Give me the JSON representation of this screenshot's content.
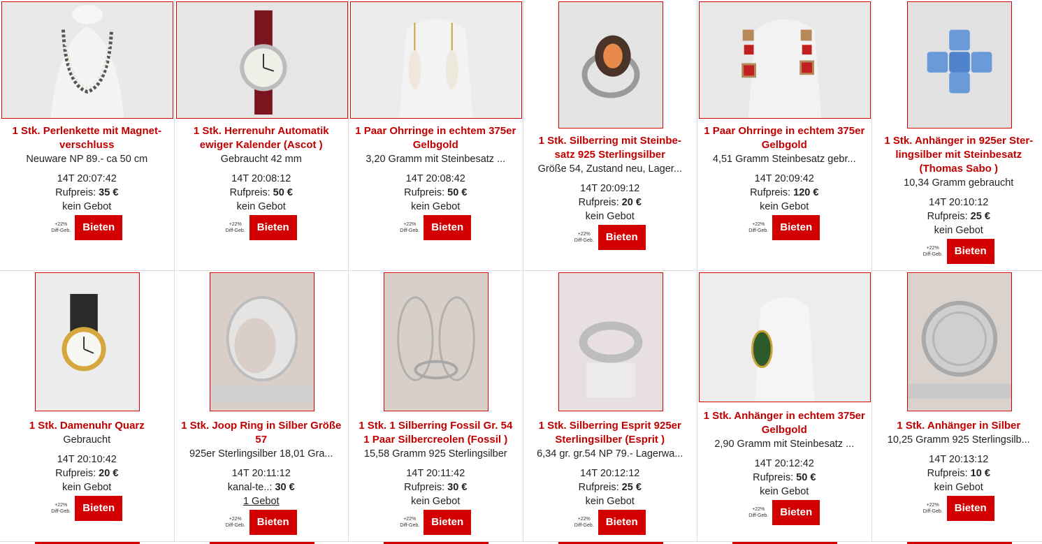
{
  "bid_button_label": "Bieten",
  "fee_note": [
    "+22%",
    "Diff-Geb."
  ],
  "price_label": "Rufpreis:",
  "colors": {
    "accent": "#d20000",
    "title": "#c00000"
  },
  "items": [
    {
      "title": "1 Stk. Perlenkette mit Magnet-verschluss",
      "desc": "Neuware NP 89.- ca 50 cm",
      "time": "14T 20:07:42",
      "price_label": "Rufpreis:",
      "price": "35 €",
      "bids": "kein Gebot",
      "image_icon": "necklace-icon"
    },
    {
      "title": "1 Stk. Herrenuhr Automatik ewiger Kalender (Ascot )",
      "desc": "Gebraucht 42 mm",
      "time": "14T 20:08:12",
      "price_label": "Rufpreis:",
      "price": "50 €",
      "bids": "kein Gebot",
      "image_icon": "watch-icon"
    },
    {
      "title": "1 Paar Ohrringe in echtem 375er Gelbgold",
      "desc": "3,20 Gramm mit Steinbesatz ...",
      "time": "14T 20:08:42",
      "price_label": "Rufpreis:",
      "price": "50 €",
      "bids": "kein Gebot",
      "image_icon": "earrings-icon"
    },
    {
      "title": "1 Stk. Silberring mit Steinbe-satz 925 Sterlingsilber",
      "desc": "Größe 54, Zustand neu, Lager...",
      "time": "14T 20:09:12",
      "price_label": "Rufpreis:",
      "price": "20 €",
      "bids": "kein Gebot",
      "image_icon": "ring-icon"
    },
    {
      "title": "1 Paar Ohrringe in echtem 375er Gelbgold",
      "desc": "4,51 Gramm Steinbesatz gebr...",
      "time": "14T 20:09:42",
      "price_label": "Rufpreis:",
      "price": "120 €",
      "bids": "kein Gebot",
      "image_icon": "earrings-icon"
    },
    {
      "title": "1 Stk. Anhänger in 925er Ster-lingsilber mit Steinbesatz (Thomas Sabo )",
      "desc": "10,34 Gramm gebraucht",
      "time": "14T 20:10:12",
      "price_label": "Rufpreis:",
      "price": "25 €",
      "bids": "kein Gebot",
      "image_icon": "pendant-icon"
    },
    {
      "title": "1 Stk. Damenuhr Quarz",
      "desc": "Gebraucht",
      "time": "14T 20:10:42",
      "price_label": "Rufpreis:",
      "price": "20 €",
      "bids": "kein Gebot",
      "image_icon": "watch-icon"
    },
    {
      "title": "1 Stk. Joop Ring in Silber Größe 57",
      "desc": "925er Sterlingsilber 18,01 Gra...",
      "time": "14T 20:11:12",
      "price_label": "kanal-te..:",
      "price": "30 €",
      "bids": "1 Gebot",
      "bids_link": true,
      "image_icon": "ring-icon"
    },
    {
      "title": "1 Stk. 1 Silberring Fossil Gr. 54 1 Paar Silbercreolen (Fossil )",
      "desc": "15,58 Gramm 925 Sterlingsilber",
      "time": "14T 20:11:42",
      "price_label": "Rufpreis:",
      "price": "30 €",
      "bids": "kein Gebot",
      "image_icon": "hoop-earrings-icon"
    },
    {
      "title": "1 Stk. Silberring Esprit 925er Sterlingsilber (Esprit )",
      "desc": "6,34 gr. gr.54 NP 79.- Lagerwa...",
      "time": "14T 20:12:12",
      "price_label": "Rufpreis:",
      "price": "25 €",
      "bids": "kein Gebot",
      "image_icon": "ring-icon"
    },
    {
      "title": "1 Stk. Anhänger in echtem 375er Gelbgold",
      "desc": "2,90 Gramm mit Steinbesatz ...",
      "time": "14T 20:12:42",
      "price_label": "Rufpreis:",
      "price": "50 €",
      "bids": "kein Gebot",
      "image_icon": "pendant-icon"
    },
    {
      "title": "1 Stk. Anhänger in Silber",
      "desc": "10,25 Gramm 925 Sterlingsilb...",
      "time": "14T 20:13:12",
      "price_label": "Rufpreis:",
      "price": "10 €",
      "bids": "kein Gebot",
      "image_icon": "coin-pendant-icon"
    }
  ]
}
